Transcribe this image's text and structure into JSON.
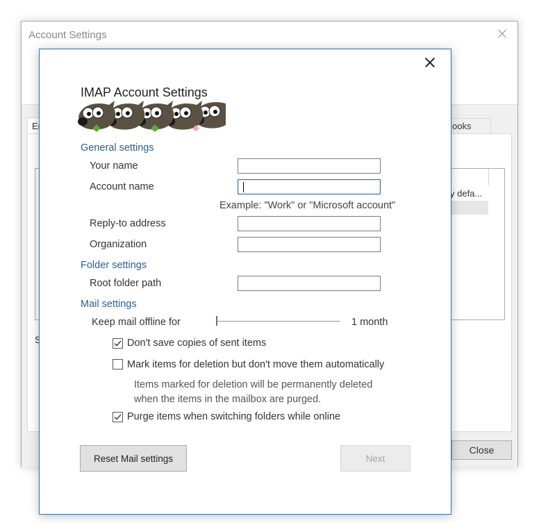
{
  "background_window": {
    "title": "Account Settings",
    "tab_left_fragment": "Er",
    "tab_right_fragment": "ooks",
    "list_row_fragment": "y defa...",
    "s_fragment": "S",
    "close_button": "Close"
  },
  "dialog": {
    "title": "IMAP Account Settings",
    "sections": {
      "general": "General settings",
      "folder": "Folder settings",
      "mail": "Mail settings"
    },
    "fields": {
      "your_name": {
        "label": "Your name",
        "value": ""
      },
      "account_name": {
        "label": "Account name",
        "value": ""
      },
      "account_name_hint": "Example: \"Work\" or \"Microsoft account\"",
      "reply_to": {
        "label": "Reply-to address",
        "value": ""
      },
      "organization": {
        "label": "Organization",
        "value": ""
      },
      "root_folder": {
        "label": "Root folder path",
        "value": ""
      }
    },
    "offline": {
      "label": "Keep mail offline for",
      "value": "1 month",
      "slider_fraction": 0.0
    },
    "checkboxes": {
      "dont_save_sent": {
        "label": "Don't save copies of sent items",
        "checked": true
      },
      "mark_for_deletion": {
        "label": "Mark items for deletion but don't move them automatically",
        "checked": false
      },
      "deletion_note_line1": "Items marked for deletion will be permanently deleted",
      "deletion_note_line2": "when the items in the mailbox are purged.",
      "purge_switching": {
        "label": "Purge items when switching folders while online",
        "checked": true
      }
    },
    "buttons": {
      "reset": "Reset Mail settings",
      "next": "Next"
    }
  },
  "colors": {
    "section_heading": "#2e5e91",
    "dialog_border": "#2f6ea8",
    "disabled_text": "#a5a5a5"
  },
  "icons": [
    "close-icon",
    "gimp-mascot-icon",
    "checkmark-icon"
  ]
}
